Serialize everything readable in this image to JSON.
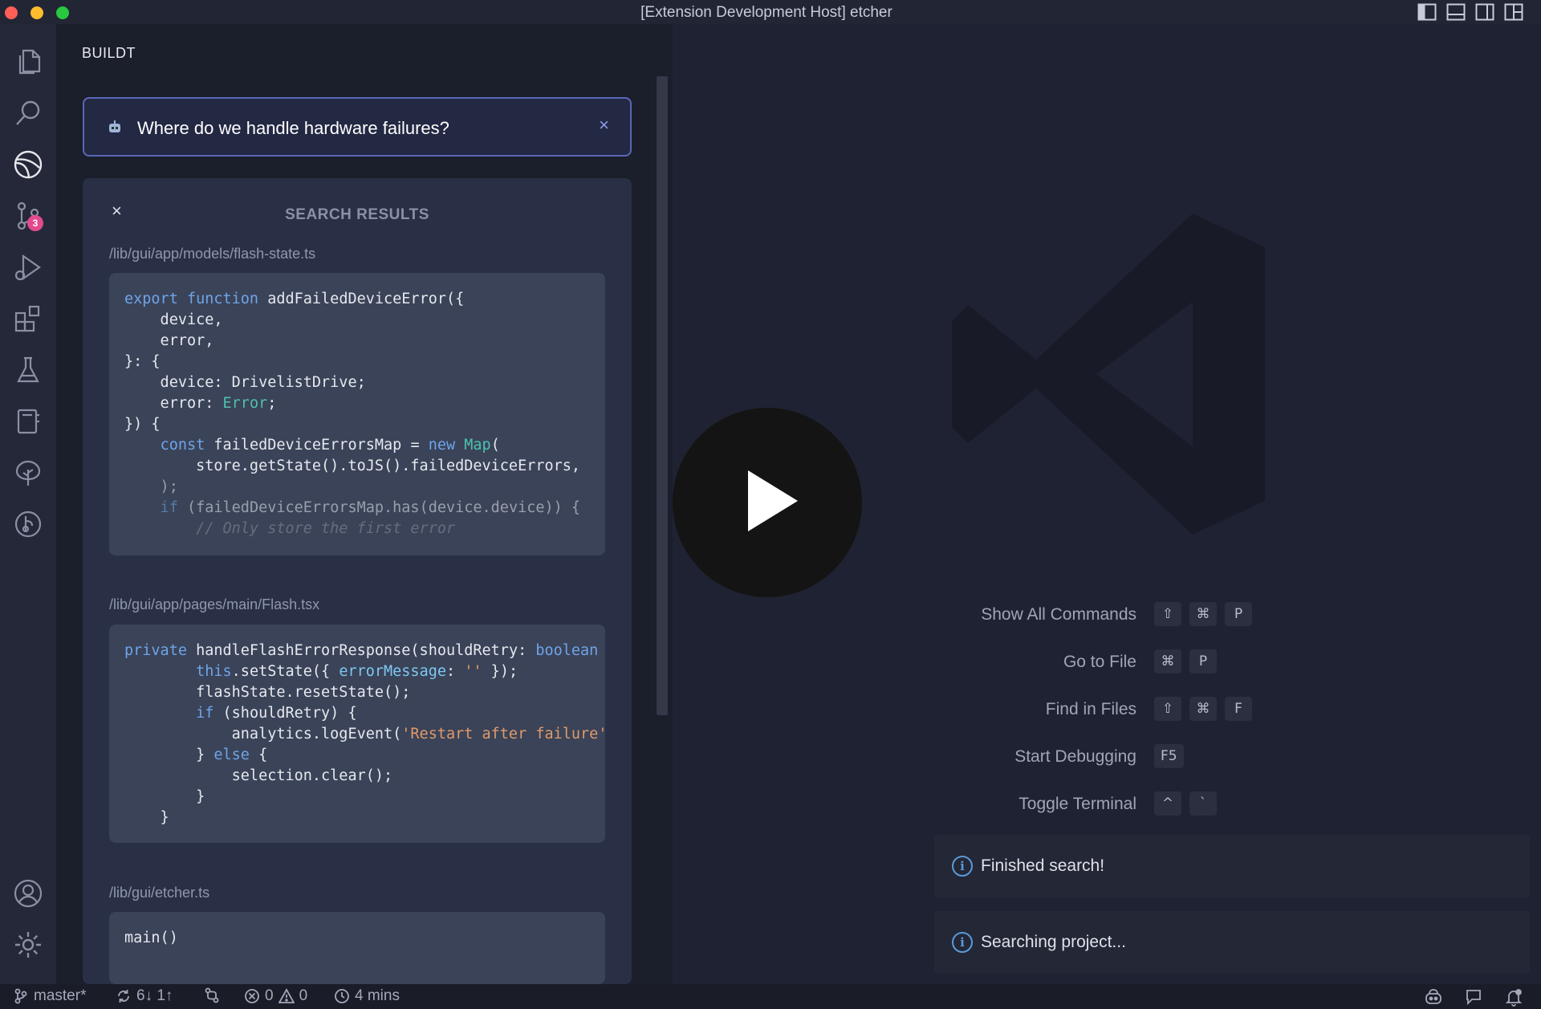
{
  "window": {
    "title": "[Extension Development Host] etcher"
  },
  "sidebar": {
    "title": "BUILDT",
    "search": {
      "value": "Where do we handle hardware failures?",
      "clear_icon": "×"
    },
    "results": {
      "close_icon": "×",
      "title": "SEARCH RESULTS",
      "items": [
        {
          "path": "/lib/gui/app/models/flash-state.ts",
          "function_name": "addFailedDeviceError"
        },
        {
          "path": "/lib/gui/app/pages/main/Flash.tsx",
          "function_name": "handleFlashErrorResponse"
        },
        {
          "path": "/lib/gui/etcher.ts",
          "code": "main()"
        }
      ]
    }
  },
  "activity_bar": {
    "source_control_badge": "3"
  },
  "editor": {
    "commands": [
      {
        "label": "Show All Commands",
        "keys": [
          "⇧",
          "⌘",
          "P"
        ]
      },
      {
        "label": "Go to File",
        "keys": [
          "⌘",
          "P"
        ]
      },
      {
        "label": "Find in Files",
        "keys": [
          "⇧",
          "⌘",
          "F"
        ]
      },
      {
        "label": "Start Debugging",
        "keys": [
          "F5"
        ]
      },
      {
        "label": "Toggle Terminal",
        "keys": [
          "^",
          "`"
        ]
      }
    ],
    "notifications": [
      {
        "icon": "info-icon",
        "text": "Finished search!"
      },
      {
        "icon": "info-icon",
        "text": "Searching project..."
      }
    ]
  },
  "statusbar": {
    "branch": "master*",
    "sync": "6↓ 1↑",
    "errors": "0",
    "warnings": "0",
    "time": "4 mins"
  },
  "colors": {
    "accent": "#5a67b8",
    "badge": "#e24a8d",
    "keyword": "#6fa4e8",
    "type": "#4fc1b0",
    "string": "#e09a6a"
  }
}
